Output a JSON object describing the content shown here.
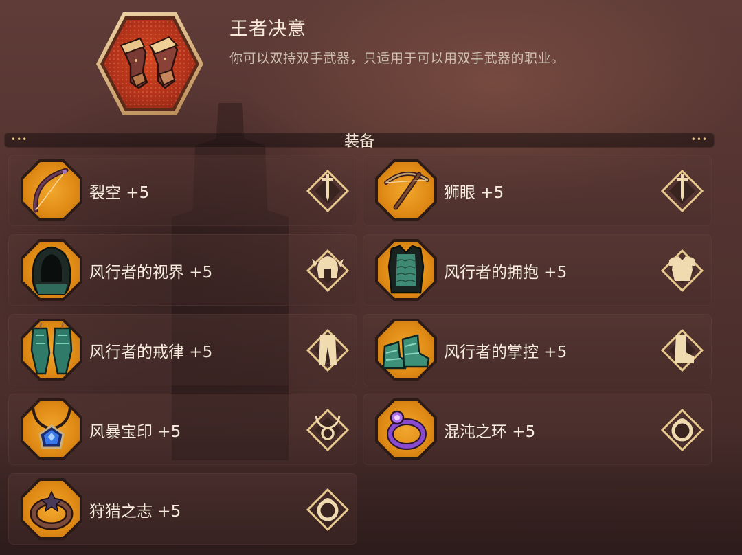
{
  "perk": {
    "title": "王者决意",
    "description": "你可以双持双手武器，只适用于可以用双手武器的职业。",
    "icon": "gauntlets-icon"
  },
  "section": {
    "title": "装备",
    "ornament_left": "•••",
    "ornament_right": "•••"
  },
  "items": [
    {
      "name": "裂空 +5",
      "item_icon": "bow-icon",
      "slot_icon": "weapon-slot-icon"
    },
    {
      "name": "狮眼 +5",
      "item_icon": "crossbow-icon",
      "slot_icon": "weapon-slot-icon"
    },
    {
      "name": "风行者的视界 +5",
      "item_icon": "hood-icon",
      "slot_icon": "helmet-slot-icon"
    },
    {
      "name": "风行者的拥抱 +5",
      "item_icon": "chest-armor-icon",
      "slot_icon": "chest-slot-icon"
    },
    {
      "name": "风行者的戒律 +5",
      "item_icon": "leg-armor-icon",
      "slot_icon": "pants-slot-icon"
    },
    {
      "name": "风行者的掌控 +5",
      "item_icon": "boots-icon",
      "slot_icon": "boots-slot-icon"
    },
    {
      "name": "风暴宝印 +5",
      "item_icon": "amulet-icon",
      "slot_icon": "amulet-slot-icon"
    },
    {
      "name": "混沌之环 +5",
      "item_icon": "ring-icon",
      "slot_icon": "ring-slot-icon"
    },
    {
      "name": "狩猎之志 +5",
      "item_icon": "ring-icon",
      "slot_icon": "ring-slot-icon"
    }
  ],
  "colors": {
    "slot_orange": "#e58f17",
    "perk_red": "#c23c1c",
    "gold": "#e8c98e"
  }
}
